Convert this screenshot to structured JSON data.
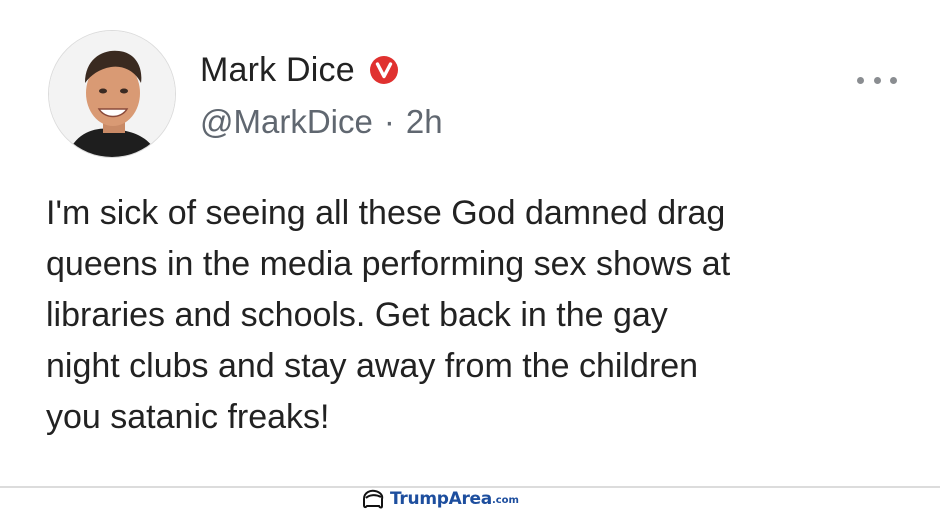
{
  "post": {
    "author": {
      "display_name": "Mark Dice",
      "verified_icon": "verified-v-icon",
      "handle": "@MarkDice",
      "separator": "·",
      "time_ago": "2h"
    },
    "more_icon": "more-horizontal-icon",
    "text": "I'm sick of seeing all these God damned drag\nqueens in the media performing sex shows at\nlibraries and schools. Get back in the gay\nnight clubs and stay away from the children\nyou satanic freaks!"
  },
  "watermark": {
    "brand": "TrumpArea",
    "suffix": ".com"
  },
  "colors": {
    "verified_red": "#e0312f",
    "handle_gray": "#606770",
    "watermark_blue": "#1d4e9e"
  }
}
